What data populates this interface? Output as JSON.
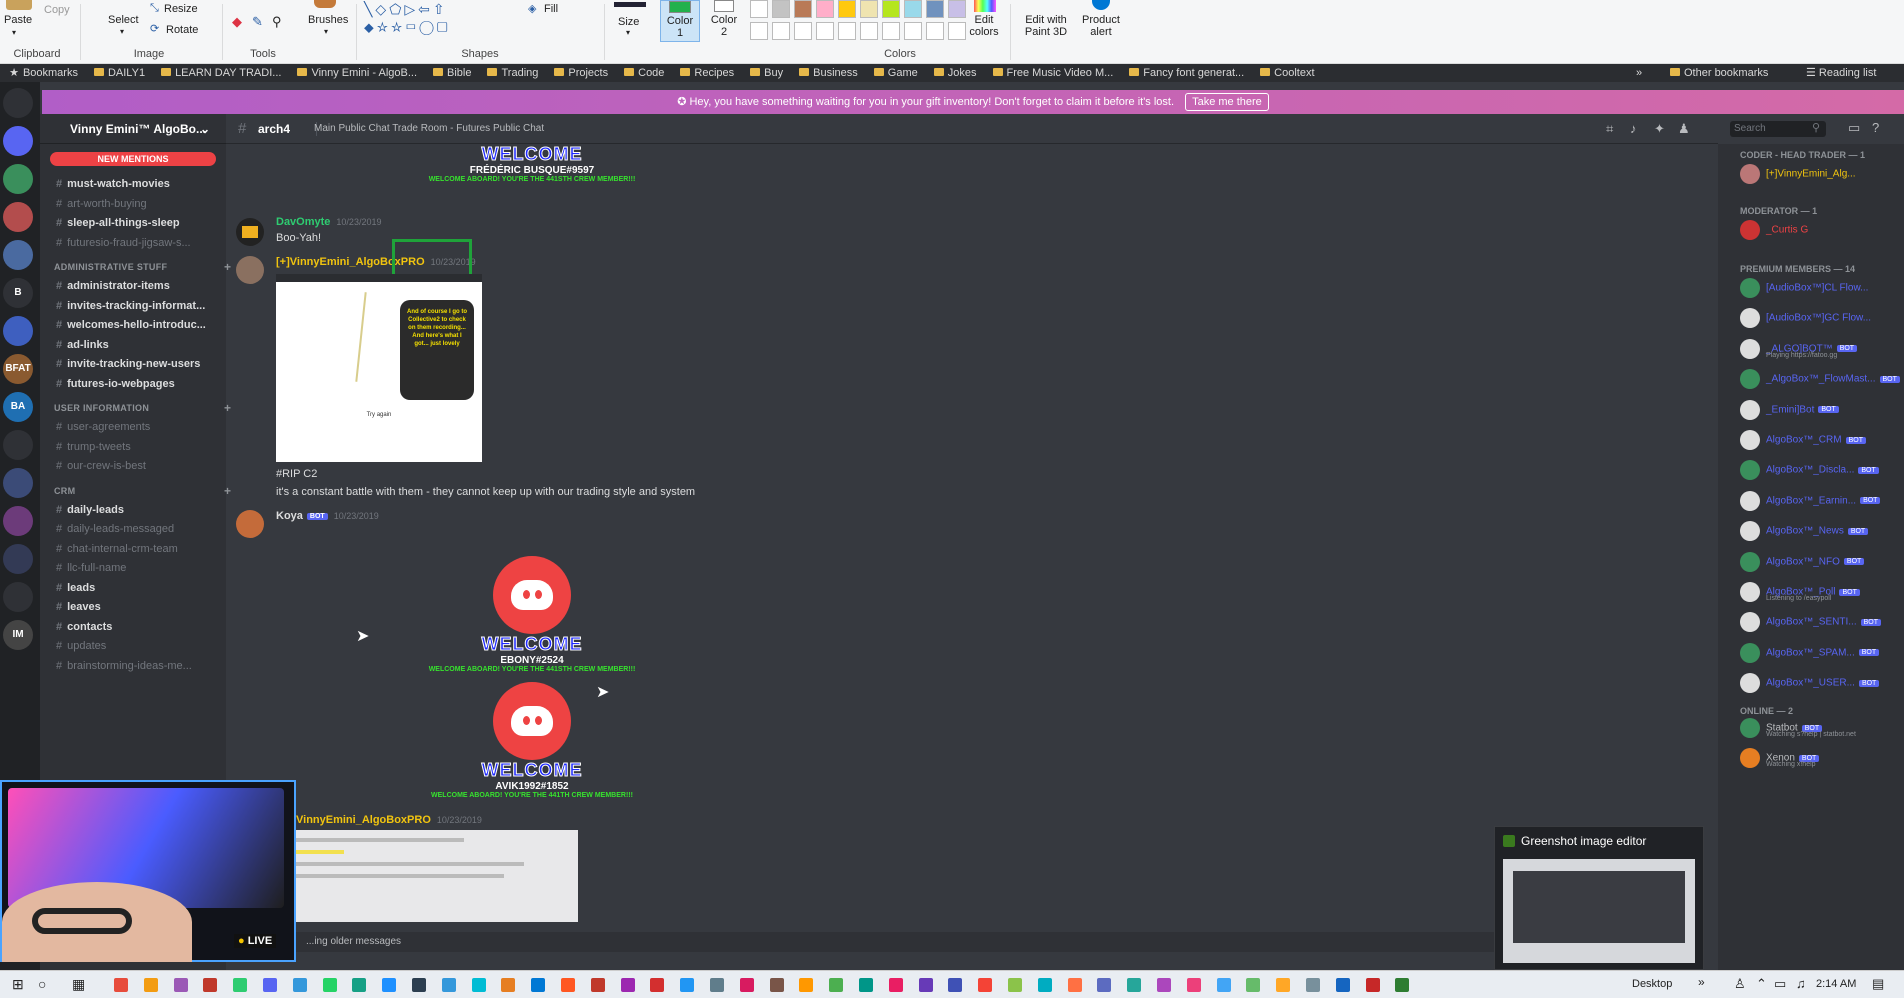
{
  "ribbon": {
    "clipboard": {
      "paste": "Paste",
      "copy": "Copy",
      "title": "Clipboard"
    },
    "image": {
      "select": "Select",
      "resize": "Resize",
      "rotate": "Rotate",
      "title": "Image"
    },
    "tools": {
      "title": "Tools"
    },
    "brushes": "Brushes",
    "shapes": {
      "fill": "Fill",
      "title": "Shapes"
    },
    "size": "Size",
    "color1": "Color\n1",
    "color2": "Color\n2",
    "colors_title": "Colors",
    "edit_colors": "Edit colors",
    "edit_paint3d": "Edit with Paint 3D",
    "product_alert": "Product alert",
    "palette": [
      "#ffffff",
      "#c3c3c3",
      "#b97a57",
      "#ffaec9",
      "#ffc90e",
      "#efe4b0",
      "#b5e61d",
      "#99d9ea",
      "#7092be",
      "#c8bfe7"
    ]
  },
  "bookmarks": {
    "items": [
      "Bookmarks",
      "DAILY1",
      "LEARN DAY TRADI...",
      "Vinny Emini - AlgoB...",
      "Bible",
      "Trading",
      "Projects",
      "Code",
      "Recipes",
      "Buy",
      "Business",
      "Game",
      "Jokes",
      "Free Music Video M...",
      "Fancy font generat...",
      "Cooltext"
    ],
    "other": "Other bookmarks",
    "reading": "Reading list"
  },
  "banner": {
    "text": "Hey, you have something waiting for you in your gift inventory! Don't forget to claim it before it's lost.",
    "button": "Take me there"
  },
  "guild": {
    "name": "Vinny Emini™ AlgoBo...",
    "new_mentions": "NEW MENTIONS"
  },
  "channels": [
    {
      "name": "must-watch-movies",
      "unread": true
    },
    {
      "name": "art-worth-buying",
      "unread": false
    },
    {
      "name": "sleep-all-things-sleep",
      "unread": true
    },
    {
      "name": "futuresio-fraud-jigsaw-s...",
      "unread": false
    },
    {
      "cat": "ADMINISTRATIVE STUFF"
    },
    {
      "name": "administrator-items",
      "unread": true
    },
    {
      "name": "invites-tracking-informat...",
      "unread": true
    },
    {
      "name": "welcomes-hello-introduc...",
      "unread": true
    },
    {
      "name": "ad-links",
      "unread": true
    },
    {
      "name": "invite-tracking-new-users",
      "unread": true
    },
    {
      "name": "futures-io-webpages",
      "unread": true
    },
    {
      "cat": "USER INFORMATION"
    },
    {
      "name": "user-agreements",
      "unread": false
    },
    {
      "name": "trump-tweets",
      "unread": false
    },
    {
      "name": "our-crew-is-best",
      "unread": false
    },
    {
      "cat": "CRM"
    },
    {
      "name": "daily-leads",
      "unread": true
    },
    {
      "name": "daily-leads-messaged",
      "unread": false
    },
    {
      "name": "chat-internal-crm-team",
      "unread": false
    },
    {
      "name": "llc-full-name",
      "unread": false
    },
    {
      "name": "leads",
      "unread": true
    },
    {
      "name": "leaves",
      "unread": true
    },
    {
      "name": "contacts",
      "unread": true
    },
    {
      "name": "updates",
      "unread": false
    },
    {
      "name": "brainstorming-ideas-me...",
      "unread": false
    }
  ],
  "chat": {
    "channel": "arch4",
    "topic": "Main Public Chat Trade Room - Futures Public Chat",
    "search_placeholder": "Search",
    "welcome1": {
      "title": "WELCOME",
      "name": "FRÉDÉRIC BUSQUE#9597",
      "sub": "WELCOME ABOARD! YOU'RE THE 441STH CREW MEMBER!!!"
    },
    "msg1": {
      "author": "DavOmyte",
      "time": "10/23/2019",
      "text": "Boo-Yah!"
    },
    "msg2": {
      "author": "[+]VinnyEmini_AlgoBoxPRO",
      "time": "10/23/2019",
      "img_bubble": "And of course I go to Collective2 to check on them recording... And here's what I got... just lovely",
      "img_caption": "Try again",
      "line1": "#RIP C2",
      "line2": "it's a constant battle with them - they cannot keep up with our trading style and system"
    },
    "msg3": {
      "author": "Koya",
      "bot": "BOT",
      "time": "10/23/2019"
    },
    "welcome2": {
      "title": "WELCOME",
      "name": "EBONY#2524",
      "sub": "WELCOME ABOARD! YOU'RE THE 441STH CREW MEMBER!!!"
    },
    "welcome3": {
      "title": "WELCOME",
      "name": "AVIK1992#1852",
      "sub": "WELCOME ABOARD! YOU'RE THE 441TH CREW MEMBER!!!"
    },
    "msg4": {
      "author": "VinnyEmini_AlgoBoxPRO",
      "time": "10/23/2019"
    },
    "loading": "...ing older messages"
  },
  "members": {
    "cat_head": "CODER - HEAD TRADER — 1",
    "head": "[+]VinnyEmini_Alg...",
    "cat_mod": "MODERATOR — 1",
    "mod": "_Curtis G",
    "cat_premium": "PREMIUM MEMBERS — 14",
    "premium": [
      "[AudioBox™]CL Flow...",
      "[AudioBox™]GC Flow...",
      "_ALGO]BOT™",
      "_AlgoBox™_FlowMast...",
      "_Emini]Bot",
      "AlgoBox™_CRM",
      "AlgoBox™_Discla...",
      "AlgoBox™_Earnin...",
      "AlgoBox™_News",
      "AlgoBox™_NFO",
      "AlgoBox™_Poll",
      "AlgoBox™_SENTI...",
      "AlgoBox™_SPAM...",
      "AlgoBox™_USER..."
    ],
    "premium_sub": {
      "2": "Playing https://fatoo.gg",
      "10": "Listening to /easypoll"
    },
    "cat_online": "ONLINE — 2",
    "online": [
      {
        "name": "Statbot",
        "sub": "Watching s?help | statbot.net"
      },
      {
        "name": "Xenon",
        "sub": "Watching x!help"
      }
    ],
    "bot": "BOT"
  },
  "greenshot": {
    "title": "Greenshot image editor"
  },
  "webcam": {
    "live": "LIVE"
  },
  "taskbar": {
    "desktop": "Desktop",
    "time": "2:14 AM"
  }
}
